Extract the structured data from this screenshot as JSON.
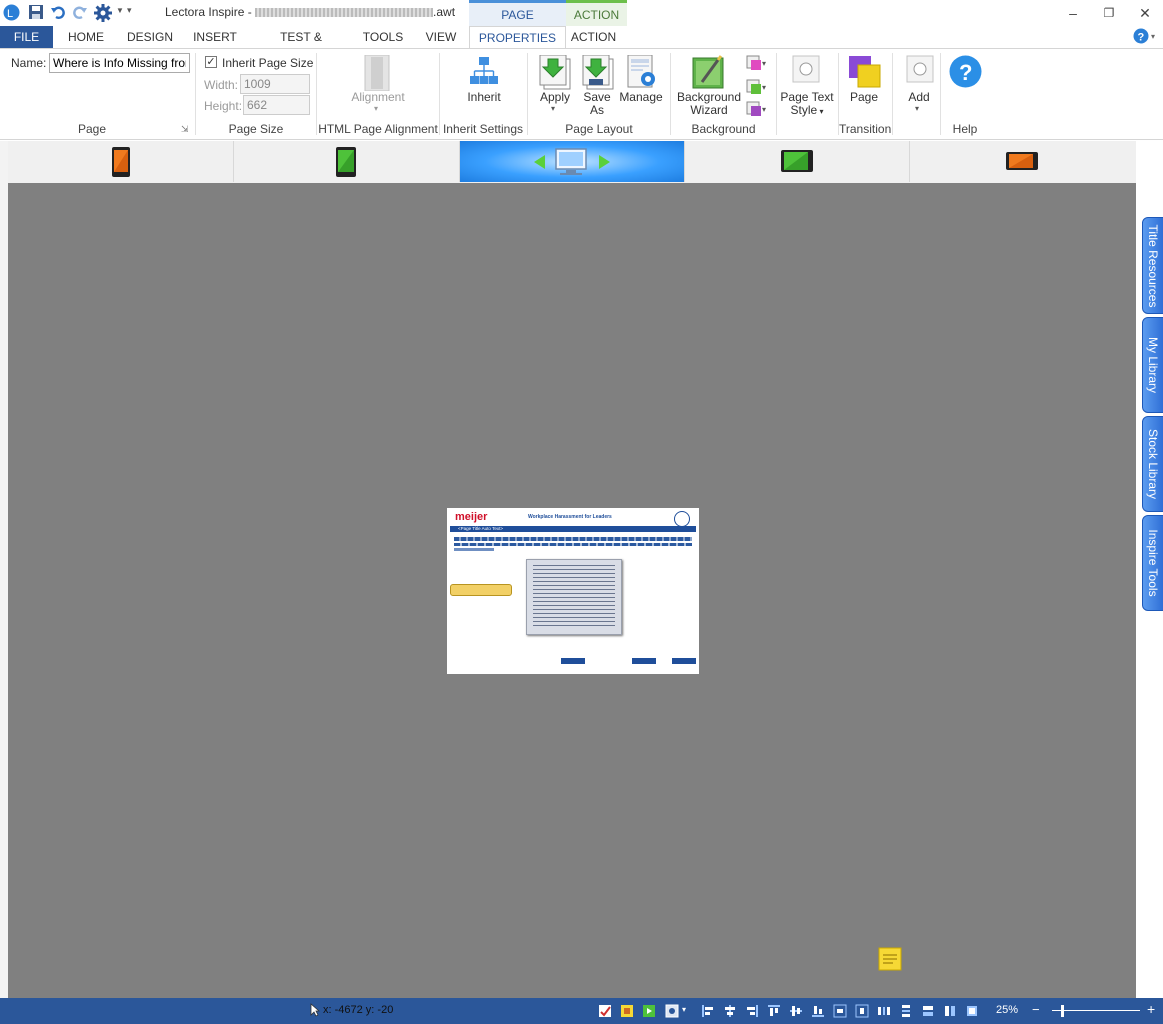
{
  "titlebar": {
    "title": "Lectora Inspire - ",
    "filename_suffix": ".awt",
    "context_tabs": [
      "PAGE",
      "ACTION"
    ]
  },
  "menu": {
    "tabs": [
      "FILE",
      "HOME",
      "DESIGN",
      "INSERT",
      "TEST & SURVEY",
      "TOOLS",
      "VIEW",
      "PROPERTIES",
      "ACTION"
    ],
    "active": "PROPERTIES"
  },
  "ribbon": {
    "page": {
      "name_label": "Name:",
      "name_value": "Where is Info Missing from",
      "group_label": "Page"
    },
    "page_size": {
      "inherit_label": "Inherit Page Size",
      "inherit_checked": true,
      "width_label": "Width:",
      "width_value": "1009",
      "height_label": "Height:",
      "height_value": "662",
      "group_label": "Page Size"
    },
    "alignment": {
      "button_label": "Alignment",
      "group_label": "HTML Page Alignment"
    },
    "inherit": {
      "button_label": "Inherit",
      "group_label": "Inherit Settings"
    },
    "page_layout": {
      "apply_label": "Apply",
      "save_as_label_1": "Save",
      "save_as_label_2": "As",
      "manage_label": "Manage",
      "group_label": "Page Layout"
    },
    "background": {
      "wizard_label_1": "Background",
      "wizard_label_2": "Wizard",
      "group_label": "Background"
    },
    "text_style": {
      "label_1": "Page Text",
      "label_2": "Style"
    },
    "transition": {
      "page_label": "Page",
      "group_label": "Transition"
    },
    "add": {
      "label": "Add"
    },
    "help": {
      "group_label": "Help"
    }
  },
  "side_panels": [
    "Title Resources",
    "My Library",
    "Stock Library",
    "Inspire Tools"
  ],
  "thumbnail": {
    "logo": "meijer",
    "course_title": "Workplace Harassment for Leaders",
    "page_title_placeholder": "<Page Title Auto Text>"
  },
  "statusbar": {
    "coords": "x: -4672  y: -20",
    "zoom": "25%",
    "zoom_minus": "−",
    "zoom_plus": "+"
  },
  "colors": {
    "accent": "#2b579a",
    "canvas": "#808080",
    "selected_device": "#2f8ef0"
  }
}
